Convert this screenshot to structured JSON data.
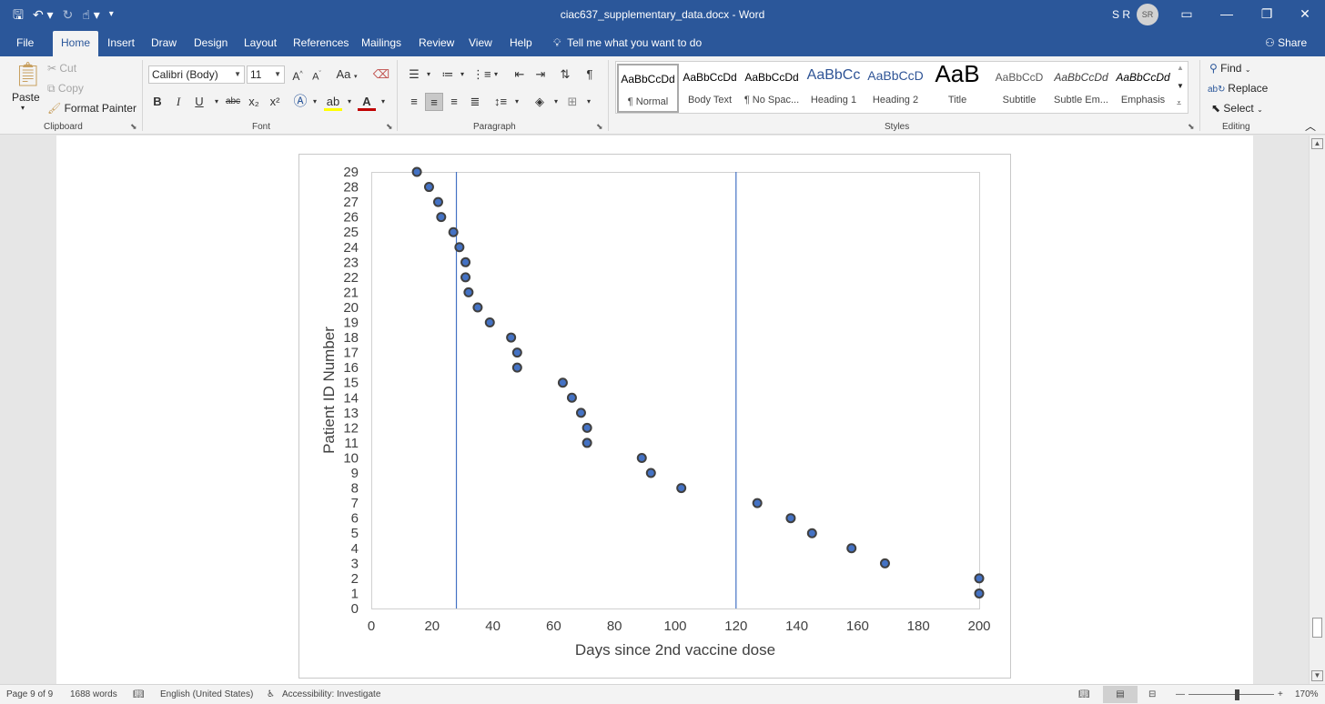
{
  "window": {
    "title": "ciac637_supplementary_data.docx  -  Word",
    "user_initials_text": "S R",
    "avatar_text": "SR"
  },
  "qat": {
    "save_icon": "save-icon",
    "undo_icon": "undo-icon",
    "redo_icon": "redo-icon",
    "touch_icon": "touch-mode-icon",
    "customize_icon": "customize-icon"
  },
  "tabs": [
    {
      "label": "File"
    },
    {
      "label": "Home"
    },
    {
      "label": "Insert"
    },
    {
      "label": "Draw"
    },
    {
      "label": "Design"
    },
    {
      "label": "Layout"
    },
    {
      "label": "References"
    },
    {
      "label": "Mailings"
    },
    {
      "label": "Review"
    },
    {
      "label": "View"
    },
    {
      "label": "Help"
    }
  ],
  "tell_me": "Tell me what you want to do",
  "share": "Share",
  "ribbon": {
    "clipboard": {
      "label": "Clipboard",
      "paste": "Paste",
      "cut": "Cut",
      "copy": "Copy",
      "format_painter": "Format Painter"
    },
    "font": {
      "label": "Font",
      "font_name": "Calibri (Body)",
      "font_size": "11",
      "bold": "B",
      "italic": "I",
      "underline": "U",
      "strike": "abc",
      "sub": "x₂",
      "sup": "x²",
      "change_case": "Aa",
      "grow": "A",
      "shrink": "A"
    },
    "paragraph": {
      "label": "Paragraph"
    },
    "styles": {
      "label": "Styles",
      "items": [
        {
          "sample": "AaBbCcDd",
          "name": "¶ Normal"
        },
        {
          "sample": "AaBbCcDd",
          "name": "Body Text"
        },
        {
          "sample": "AaBbCcDd",
          "name": "¶ No Spac..."
        },
        {
          "sample": "AaBbCc",
          "name": "Heading 1"
        },
        {
          "sample": "AaBbCcD",
          "name": "Heading 2"
        },
        {
          "sample": "AaB",
          "name": "Title"
        },
        {
          "sample": "AaBbCcD",
          "name": "Subtitle"
        },
        {
          "sample": "AaBbCcDd",
          "name": "Subtle Em..."
        },
        {
          "sample": "AaBbCcDd",
          "name": "Emphasis"
        }
      ]
    },
    "editing": {
      "label": "Editing",
      "find": "Find",
      "replace": "Replace",
      "select": "Select"
    }
  },
  "chart_data": {
    "type": "scatter",
    "xlabel": "Days since 2nd vaccine dose",
    "ylabel": "Patient ID Number",
    "xlim": [
      0,
      200
    ],
    "ylim": [
      0,
      29
    ],
    "x_ticks": [
      "0",
      "20",
      "40",
      "60",
      "80",
      "100",
      "120",
      "140",
      "160",
      "180",
      "200"
    ],
    "y_ticks": [
      "0",
      "1",
      "2",
      "3",
      "4",
      "5",
      "6",
      "7",
      "8",
      "9",
      "10",
      "11",
      "12",
      "13",
      "14",
      "15",
      "16",
      "17",
      "18",
      "19",
      "20",
      "21",
      "22",
      "23",
      "24",
      "25",
      "26",
      "27",
      "28",
      "29"
    ],
    "vlines": [
      28,
      120
    ],
    "points": [
      {
        "x": 200,
        "y": 1
      },
      {
        "x": 200,
        "y": 2
      },
      {
        "x": 169,
        "y": 3
      },
      {
        "x": 158,
        "y": 4
      },
      {
        "x": 145,
        "y": 5
      },
      {
        "x": 138,
        "y": 6
      },
      {
        "x": 127,
        "y": 7
      },
      {
        "x": 102,
        "y": 8
      },
      {
        "x": 92,
        "y": 9
      },
      {
        "x": 89,
        "y": 10
      },
      {
        "x": 71,
        "y": 11
      },
      {
        "x": 71,
        "y": 12
      },
      {
        "x": 69,
        "y": 13
      },
      {
        "x": 66,
        "y": 14
      },
      {
        "x": 63,
        "y": 15
      },
      {
        "x": 48,
        "y": 16
      },
      {
        "x": 48,
        "y": 17
      },
      {
        "x": 46,
        "y": 18
      },
      {
        "x": 39,
        "y": 19
      },
      {
        "x": 35,
        "y": 20
      },
      {
        "x": 32,
        "y": 21
      },
      {
        "x": 31,
        "y": 22
      },
      {
        "x": 31,
        "y": 23
      },
      {
        "x": 29,
        "y": 24
      },
      {
        "x": 27,
        "y": 25
      },
      {
        "x": 23,
        "y": 26
      },
      {
        "x": 22,
        "y": 27
      },
      {
        "x": 19,
        "y": 28
      },
      {
        "x": 15,
        "y": 29
      }
    ],
    "marker_fill": "#4472c4",
    "marker_edge": "#404040",
    "line_color": "#4472c4",
    "grid": false
  },
  "status": {
    "page": "Page 9 of 9",
    "words": "1688 words",
    "language": "English (United States)",
    "accessibility": "Accessibility: Investigate",
    "zoom": "170%"
  },
  "colors": {
    "accent": "#2b579a"
  }
}
